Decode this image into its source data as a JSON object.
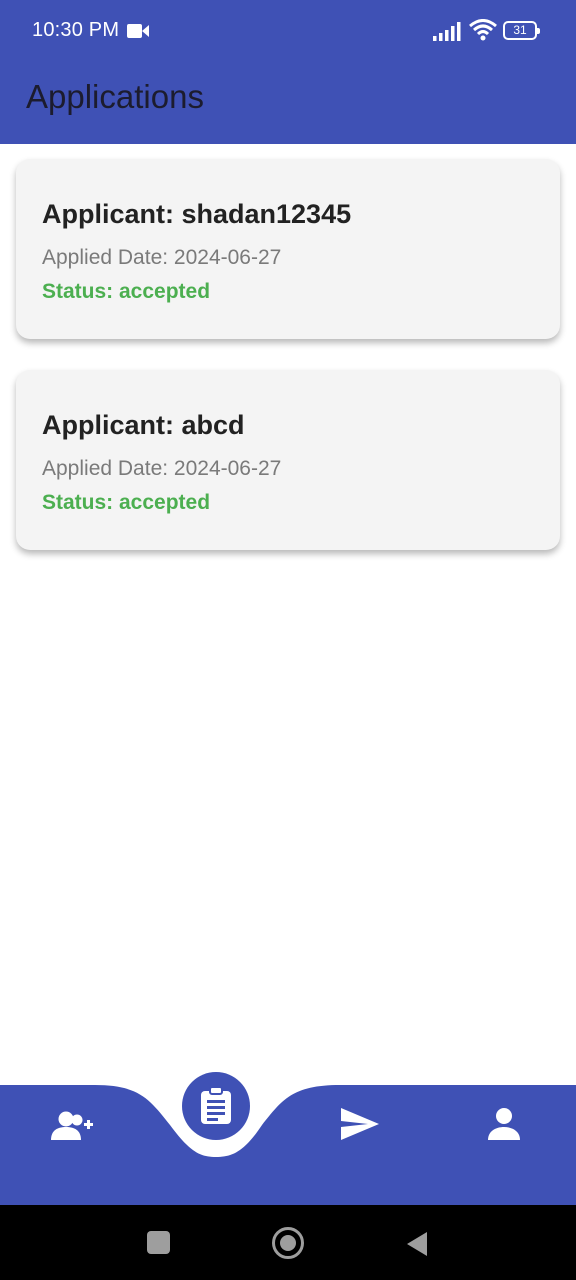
{
  "status_bar": {
    "time": "10:30 PM",
    "battery": "31",
    "icons": [
      "video-camera-icon",
      "signal-icon",
      "wifi-icon",
      "battery-icon"
    ]
  },
  "header": {
    "title": "Applications"
  },
  "applications": [
    {
      "applicant": "Applicant: shadan12345",
      "applied_date": "Applied Date: 2024-06-27",
      "status": "Status: accepted"
    },
    {
      "applicant": "Applicant: abcd",
      "applied_date": "Applied Date: 2024-06-27",
      "status": "Status: accepted"
    }
  ],
  "bottom_nav": {
    "items": [
      "add-user-icon",
      "clipboard-icon",
      "send-icon",
      "person-icon"
    ],
    "active": "clipboard-icon"
  },
  "colors": {
    "primary": "#3f51b5",
    "status_accepted": "#4caf50",
    "card_bg": "#f4f4f4"
  }
}
